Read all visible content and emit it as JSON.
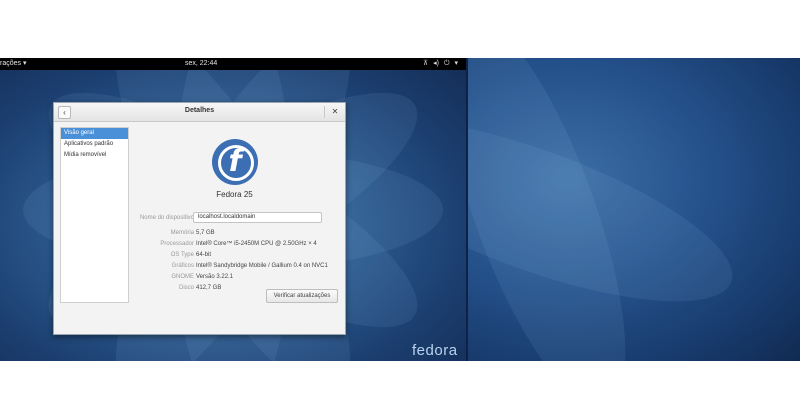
{
  "top_bar": {
    "activities_label": "rações",
    "clock": "sex, 22:44",
    "tray_icons": [
      "network-icon",
      "volume-icon",
      "power-icon"
    ],
    "tray_glyphs": [
      "⊼",
      "◂)",
      "⏻"
    ],
    "tray_arrow": "▾",
    "activities_arrow": "▾"
  },
  "wallpaper": {
    "brand": "fedora",
    "colors": {
      "dark": "#132c55",
      "mid": "#2f5f95",
      "light": "#5a8cbf"
    }
  },
  "window": {
    "title": "Detalhes",
    "back_glyph": "‹",
    "close_glyph": "✕",
    "sidebar": {
      "items": [
        {
          "label": "Visão geral",
          "selected": true
        },
        {
          "label": "Aplicativos padrão",
          "selected": false
        },
        {
          "label": "Mídia removível",
          "selected": false
        }
      ]
    },
    "overview": {
      "logo_letter": "f",
      "os_name": "Fedora 25",
      "hostname_label": "Nome do dispositivo",
      "hostname_value": "localhost.localdomain",
      "details": [
        {
          "label": "Memória",
          "value": "5,7 GB"
        },
        {
          "label": "Processador",
          "value": "Intel® Core™ i5-2450M CPU @ 2.50GHz × 4"
        },
        {
          "label": "OS Type",
          "value": "64-bit"
        },
        {
          "label": "Gráficos",
          "value": "Intel® Sandybridge Mobile  / Gallium 0.4 on NVC1"
        },
        {
          "label": "GNOME",
          "value": "Versão 3.22.1"
        },
        {
          "label": "Disco",
          "value": "412,7 GB"
        }
      ],
      "update_button": "Verificar atualizações"
    },
    "accent_color": "#4a90d9"
  }
}
